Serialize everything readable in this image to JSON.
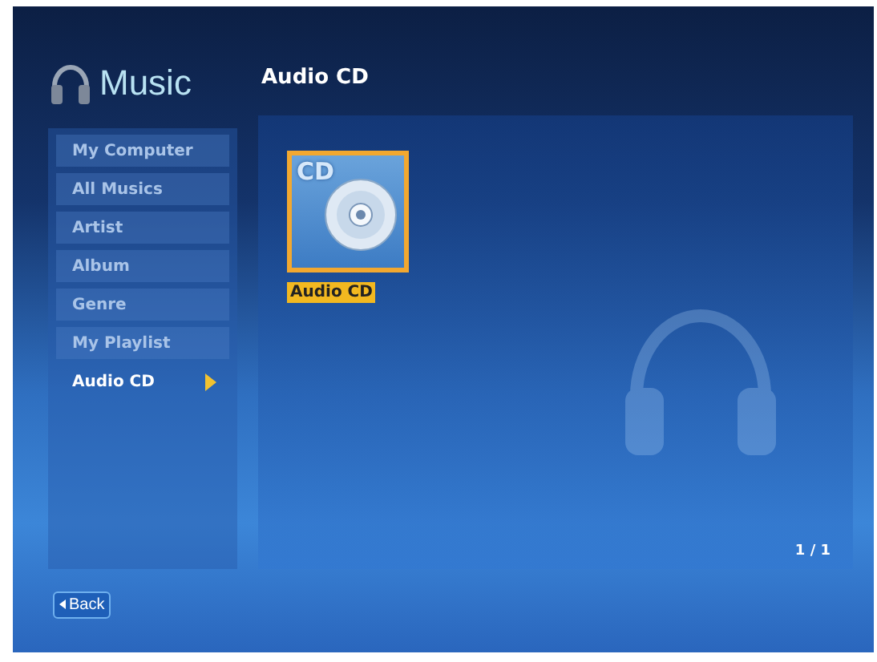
{
  "header": {
    "title": "Music"
  },
  "sidebar": {
    "items": [
      {
        "label": "My Computer",
        "selected": false
      },
      {
        "label": "All Musics",
        "selected": false
      },
      {
        "label": "Artist",
        "selected": false
      },
      {
        "label": "Album",
        "selected": false
      },
      {
        "label": "Genre",
        "selected": false
      },
      {
        "label": "My Playlist",
        "selected": false
      },
      {
        "label": "Audio CD",
        "selected": true
      }
    ]
  },
  "content": {
    "title": "Audio CD",
    "items": [
      {
        "label": "Audio CD",
        "badge": "CD",
        "selected": true
      }
    ],
    "page": "1 / 1"
  },
  "back_button": {
    "label": "Back"
  }
}
